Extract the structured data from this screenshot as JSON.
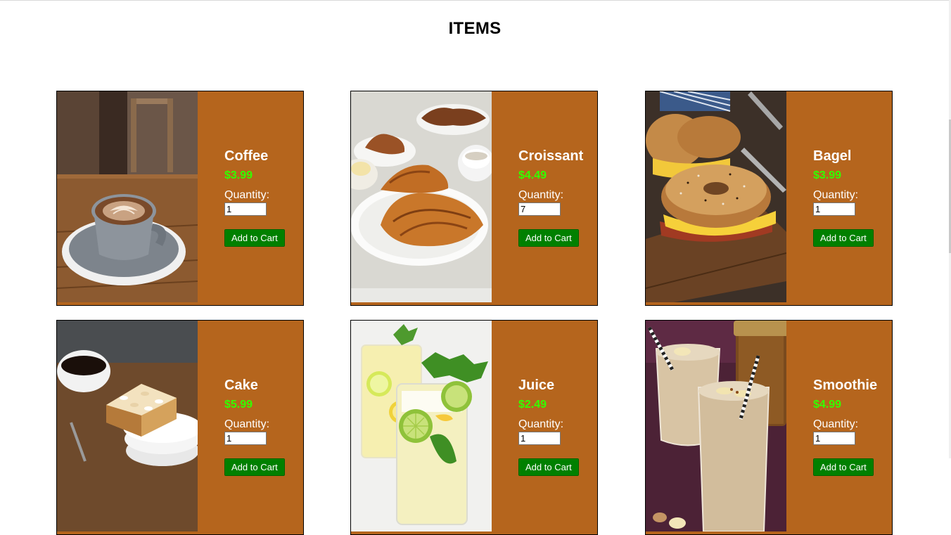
{
  "page": {
    "title": "ITEMS"
  },
  "labels": {
    "quantity": "Quantity:",
    "add_to_cart": "Add to Cart"
  },
  "colors": {
    "card_background": "#b5651d",
    "price": "#33ff00",
    "button": "#008000"
  },
  "items": [
    {
      "name": "Coffee",
      "price": "$3.99",
      "quantity": "1",
      "image": "coffee-latte-photo"
    },
    {
      "name": "Croissant",
      "price": "$4.49",
      "quantity": "7",
      "image": "croissant-plate-photo"
    },
    {
      "name": "Bagel",
      "price": "$3.99",
      "quantity": "1",
      "image": "bagel-sandwich-photo"
    },
    {
      "name": "Cake",
      "price": "$5.99",
      "quantity": "1",
      "image": "cake-slice-photo"
    },
    {
      "name": "Juice",
      "price": "$2.49",
      "quantity": "1",
      "image": "lemonade-glass-photo"
    },
    {
      "name": "Smoothie",
      "price": "$4.99",
      "quantity": "1",
      "image": "banana-smoothie-photo"
    }
  ]
}
